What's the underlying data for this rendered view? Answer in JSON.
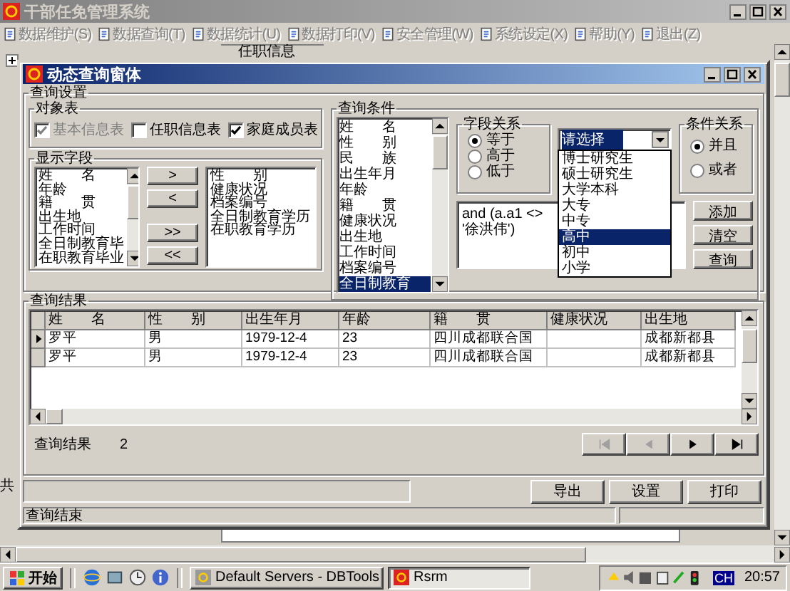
{
  "app_window": {
    "title": "干部任免管理系统"
  },
  "menu": [
    {
      "label": "数据维护(S)",
      "disabled": true
    },
    {
      "label": "数据查询(T)",
      "disabled": true
    },
    {
      "label": "数据统计(U)",
      "disabled": true
    },
    {
      "label": "数据打印(V)",
      "disabled": true
    },
    {
      "label": "安全管理(W)",
      "disabled": true
    },
    {
      "label": "系统设定(X)",
      "disabled": true
    },
    {
      "label": "帮助(Y)",
      "disabled": true
    },
    {
      "label": "退出(Z)",
      "disabled": true
    }
  ],
  "background": {
    "section_label": "任职信息",
    "total_label": "共"
  },
  "dialog": {
    "title": "动态查询窗体",
    "settings": {
      "label": "查询设置",
      "object_tables": {
        "label": "对象表",
        "items": [
          {
            "label": "基本信息表",
            "checked": true,
            "disabled": true
          },
          {
            "label": "任职信息表",
            "checked": false,
            "disabled": false
          },
          {
            "label": "家庭成员表",
            "checked": true,
            "disabled": false
          }
        ]
      },
      "display_fields": {
        "label": "显示字段",
        "available": [
          {
            "label": "姓　　名",
            "selected": false
          },
          {
            "label": "年龄",
            "selected": false
          },
          {
            "label": "籍　　贯",
            "selected": false
          },
          {
            "label": "出生地",
            "selected": false
          },
          {
            "label": "工作时间",
            "selected": false
          },
          {
            "label": "全日制教育毕",
            "selected": false
          },
          {
            "label": "在职教育毕业",
            "selected": false
          }
        ],
        "move_buttons": [
          ">",
          "<",
          ">>",
          "<<"
        ],
        "chosen": [
          {
            "label": "性　　别",
            "selected": false
          },
          {
            "label": "健康状况",
            "selected": false
          },
          {
            "label": "档案编号",
            "selected": false
          },
          {
            "label": "全日制教育学历",
            "selected": false
          },
          {
            "label": "在职教育学历",
            "selected": false
          }
        ]
      },
      "conditions": {
        "label": "查询条件",
        "fields": [
          {
            "label": "姓　　名",
            "selected": false
          },
          {
            "label": "性　　别",
            "selected": false
          },
          {
            "label": "民　　族",
            "selected": false
          },
          {
            "label": "出生年月",
            "selected": false
          },
          {
            "label": "年龄",
            "selected": false
          },
          {
            "label": "籍　　贯",
            "selected": false
          },
          {
            "label": "健康状况",
            "selected": false
          },
          {
            "label": "出生地",
            "selected": false
          },
          {
            "label": "工作时间",
            "selected": false
          },
          {
            "label": "档案编号",
            "selected": false
          },
          {
            "label": "全日制教育",
            "selected": true
          }
        ],
        "relation": {
          "label": "字段关系",
          "options": [
            {
              "label": "等于",
              "selected": true
            },
            {
              "label": "高于",
              "selected": false
            },
            {
              "label": "低于",
              "selected": false
            }
          ]
        },
        "value_combo": {
          "value": "请选择",
          "expanded": true,
          "options": [
            {
              "label": "博士研究生",
              "selected": false
            },
            {
              "label": "硕士研究生",
              "selected": false
            },
            {
              "label": "大学本科",
              "selected": false
            },
            {
              "label": "大专",
              "selected": false
            },
            {
              "label": "中专",
              "selected": false
            },
            {
              "label": "高中",
              "selected": true
            },
            {
              "label": "初中",
              "selected": false
            },
            {
              "label": "小学",
              "selected": false
            }
          ]
        },
        "logic": {
          "label": "条件关系",
          "options": [
            {
              "label": "并且",
              "selected": true
            },
            {
              "label": "或者",
              "selected": false
            }
          ]
        },
        "expression": "and (a.a1 <> '徐洪伟')",
        "buttons": [
          "添加",
          "清空",
          "查询"
        ]
      }
    },
    "results": {
      "label": "查询结果",
      "columns": [
        "姓　　名",
        "性　　别",
        "出生年月",
        "年龄",
        "籍　　贯",
        "健康状况",
        "出生地"
      ],
      "rows": [
        {
          "selected": true,
          "cells": [
            "罗平",
            "男",
            "1979-12-4",
            "23",
            "四川成都联合国",
            "",
            "成都新都县"
          ]
        },
        {
          "selected": false,
          "cells": [
            "罗平",
            "男",
            "1979-12-4",
            "23",
            "四川成都联合国",
            "",
            "成都新都县"
          ]
        }
      ],
      "count_label": "查询结果",
      "count": "2",
      "nav": [
        {
          "kind": "first",
          "disabled": true
        },
        {
          "kind": "prev",
          "disabled": true
        },
        {
          "kind": "next",
          "disabled": false
        },
        {
          "kind": "last",
          "disabled": false
        }
      ]
    },
    "actions": [
      "导出",
      "设置",
      "打印"
    ],
    "status": "查询结束"
  },
  "taskbar": {
    "start": "开始",
    "tasks": [
      {
        "label": "Default Servers - DBTools",
        "selected": false
      },
      {
        "label": "Rsrm",
        "selected": true
      }
    ],
    "input_indicator": "CH",
    "clock": "20:57"
  }
}
